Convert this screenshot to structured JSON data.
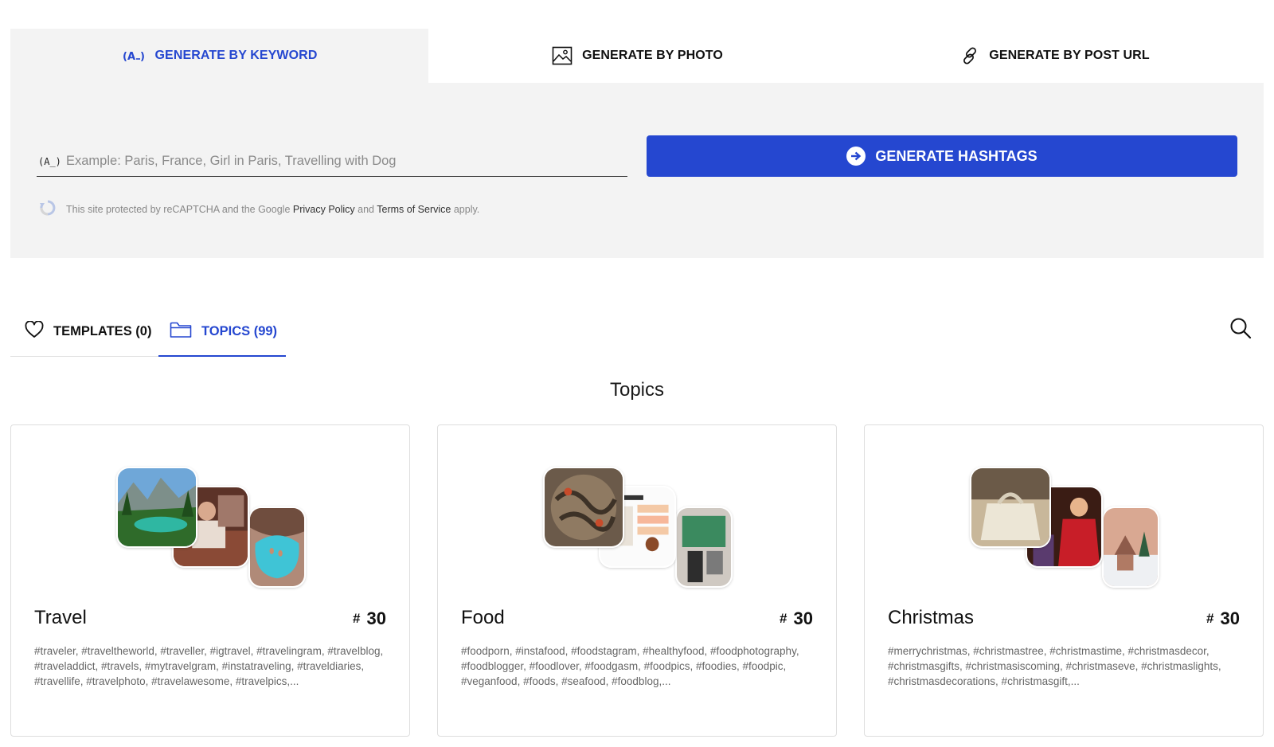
{
  "generator": {
    "tabs": [
      {
        "label": "GENERATE BY KEYWORD",
        "icon": "keyword-icon",
        "active": true
      },
      {
        "label": "GENERATE BY PHOTO",
        "icon": "image-icon",
        "active": false
      },
      {
        "label": "GENERATE BY POST URL",
        "icon": "link-icon",
        "active": false
      }
    ],
    "keyword_prefix": "(A_)",
    "keyword_placeholder": "Example: Paris, France, Girl in Paris, Travelling with Dog",
    "keyword_value": "",
    "button_label": "GENERATE HASHTAGS",
    "recaptcha": {
      "prefix": "This site protected by reCAPTCHA and the Google",
      "privacy": "Privacy Policy",
      "and": "and",
      "terms": "Terms of Service",
      "suffix": "apply."
    }
  },
  "library_tabs": [
    {
      "label": "TEMPLATES (0)",
      "icon": "heart-icon",
      "active": false
    },
    {
      "label": "TOPICS (99)",
      "icon": "folder-icon",
      "active": true
    }
  ],
  "section_title": "Topics",
  "topics": [
    {
      "name": "Travel",
      "count_symbol": "#",
      "count": "30",
      "tags": "#traveler, #traveltheworld, #traveller, #igtravel, #travelingram, #travelblog, #traveladdict, #travels, #mytravelgram, #instatraveling, #traveldiaries, #travellife, #travelphoto, #travelawesome, #travelpics,..."
    },
    {
      "name": "Food",
      "count_symbol": "#",
      "count": "30",
      "tags": "#foodporn, #instafood, #foodstagram, #healthyfood, #foodphotography, #foodblogger, #foodlover, #foodgasm, #foodpics, #foodies, #foodpic, #veganfood, #foods, #seafood, #foodblog,..."
    },
    {
      "name": "Christmas",
      "count_symbol": "#",
      "count": "30",
      "tags": "#merrychristmas, #christmastree, #christmastime, #christmasdecor, #christmasgifts, #christmasiscoming, #christmaseve, #christmaslights, #christmasdecorations, #christmasgift,..."
    }
  ],
  "colors": {
    "accent": "#2547d0",
    "panel_bg": "#f3f3f3",
    "text": "#111111",
    "muted": "#666666"
  }
}
